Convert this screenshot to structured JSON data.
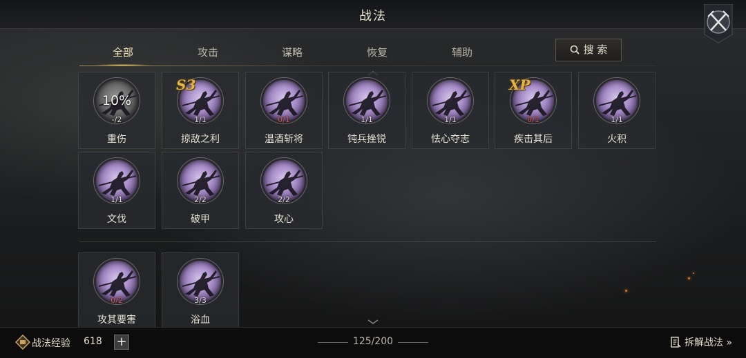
{
  "header": {
    "title": "战法"
  },
  "tabs": [
    {
      "label": "全部",
      "active": true
    },
    {
      "label": "攻击",
      "active": false
    },
    {
      "label": "谋略",
      "active": false
    },
    {
      "label": "恢复",
      "active": false
    },
    {
      "label": "辅助",
      "active": false
    }
  ],
  "search": {
    "label": "搜 索"
  },
  "skills": [
    {
      "name": "重伤",
      "count": "-/2",
      "percent": "10%",
      "badge": "",
      "count_color": "normal",
      "medal": "gray"
    },
    {
      "name": "掠敌之利",
      "count": "1/1",
      "percent": "",
      "badge": "S3",
      "count_color": "normal",
      "medal": "purple"
    },
    {
      "name": "温酒斩将",
      "count": "0/1",
      "percent": "",
      "badge": "",
      "count_color": "red",
      "medal": "purple"
    },
    {
      "name": "钝兵挫锐",
      "count": "1/1",
      "percent": "",
      "badge": "",
      "count_color": "normal",
      "medal": "purple"
    },
    {
      "name": "怯心夺志",
      "count": "1/1",
      "percent": "",
      "badge": "",
      "count_color": "normal",
      "medal": "purple"
    },
    {
      "name": "疾击其后",
      "count": "0/1",
      "percent": "",
      "badge": "XP",
      "count_color": "red",
      "medal": "purple"
    },
    {
      "name": "火积",
      "count": "1/1",
      "percent": "",
      "badge": "",
      "count_color": "normal",
      "medal": "purple"
    },
    {
      "name": "文伐",
      "count": "1/1",
      "percent": "",
      "badge": "",
      "count_color": "normal",
      "medal": "purple"
    },
    {
      "name": "破甲",
      "count": "2/2",
      "percent": "",
      "badge": "",
      "count_color": "normal",
      "medal": "purple"
    },
    {
      "name": "攻心",
      "count": "2/2",
      "percent": "",
      "badge": "",
      "count_color": "normal",
      "medal": "purple"
    },
    {
      "name": "攻其要害",
      "count": "0/2",
      "percent": "",
      "badge": "",
      "count_color": "red",
      "medal": "purple"
    },
    {
      "name": "浴血",
      "count": "3/3",
      "percent": "",
      "badge": "",
      "count_color": "normal",
      "medal": "purple"
    }
  ],
  "footer": {
    "exp_label": "战法经验",
    "exp_value": "618",
    "plus_label": "+",
    "capacity": "125/200",
    "decompose_label": "拆解战法 »"
  },
  "colors": {
    "accent_gold": "#e5b544",
    "count_red": "#d25a4a"
  }
}
